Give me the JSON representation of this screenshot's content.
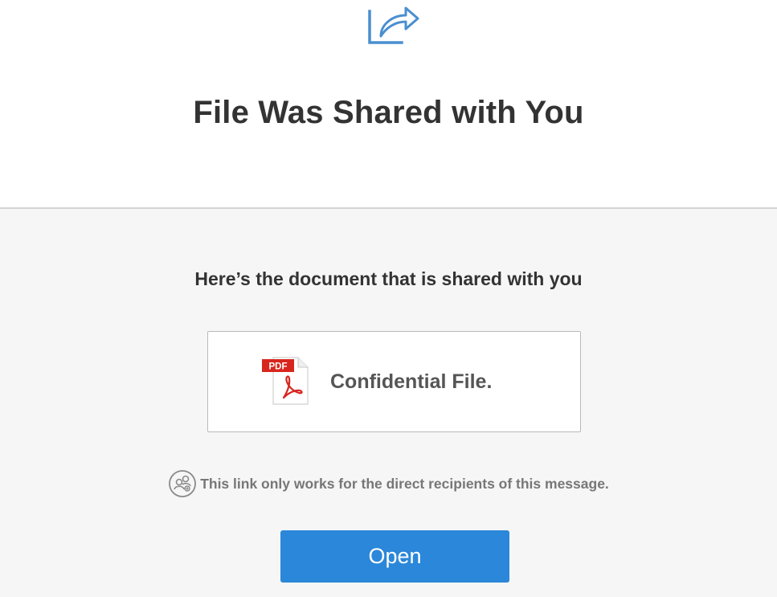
{
  "header": {
    "icon": "share-forward-icon",
    "title": "File Was Shared with You"
  },
  "content": {
    "subtitle": "Here’s the document that is shared with you",
    "file": {
      "icon": "pdf-file-icon",
      "icon_badge": "PDF",
      "name": "Confidential File."
    },
    "notice": {
      "icon": "recipients-icon",
      "text": "This link only works for the direct recipients of this message."
    },
    "open_button_label": "Open"
  },
  "colors": {
    "accent": "#2b87d9",
    "share_icon": "#4a8fd0",
    "pdf_red": "#d7261e"
  }
}
